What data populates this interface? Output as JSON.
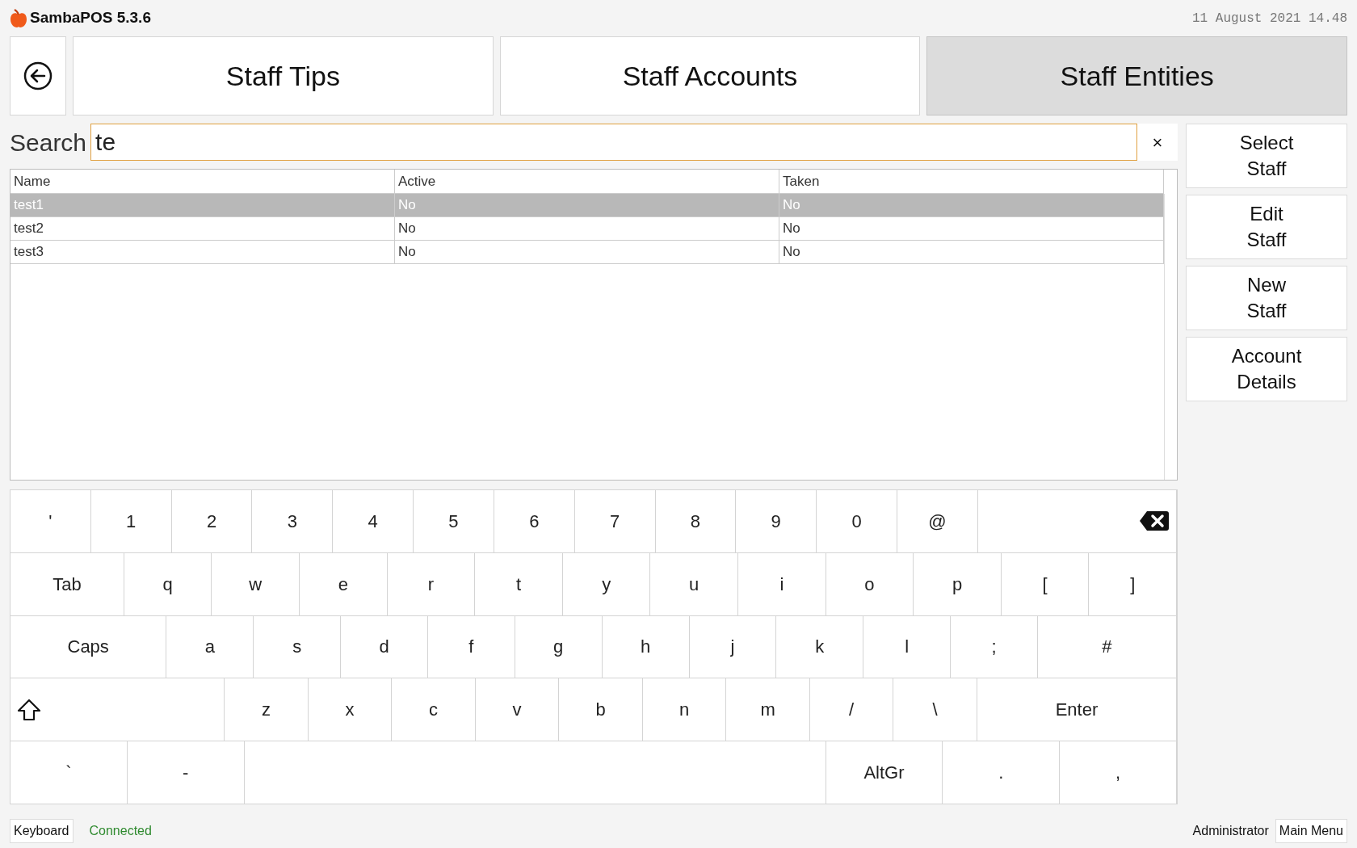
{
  "app": {
    "title": "SambaPOS 5.3.6",
    "datetime": "11 August 2021 14.48"
  },
  "tabs": [
    {
      "label": "Staff Tips",
      "selected": false
    },
    {
      "label": "Staff Accounts",
      "selected": false
    },
    {
      "label": "Staff Entities",
      "selected": true
    }
  ],
  "search": {
    "label": "Search",
    "value": "te",
    "clear": "×"
  },
  "table": {
    "columns": [
      "Name",
      "Active",
      "Taken"
    ],
    "rows": [
      {
        "cells": [
          "test1",
          "No",
          "No"
        ],
        "selected": true
      },
      {
        "cells": [
          "test2",
          "No",
          "No"
        ],
        "selected": false
      },
      {
        "cells": [
          "test3",
          "No",
          "No"
        ],
        "selected": false
      }
    ]
  },
  "actions": [
    [
      "Select",
      "Staff"
    ],
    [
      "Edit",
      "Staff"
    ],
    [
      "New",
      "Staff"
    ],
    [
      "Account",
      "Details"
    ]
  ],
  "keyboard": [
    [
      {
        "kind": "char",
        "label": "'"
      },
      {
        "kind": "char",
        "label": "1"
      },
      {
        "kind": "char",
        "label": "2"
      },
      {
        "kind": "char",
        "label": "3"
      },
      {
        "kind": "char",
        "label": "4"
      },
      {
        "kind": "char",
        "label": "5"
      },
      {
        "kind": "char",
        "label": "6"
      },
      {
        "kind": "char",
        "label": "7"
      },
      {
        "kind": "char",
        "label": "8"
      },
      {
        "kind": "char",
        "label": "9"
      },
      {
        "kind": "char",
        "label": "0"
      },
      {
        "kind": "char",
        "label": "@"
      },
      {
        "kind": "backspace"
      }
    ],
    [
      {
        "kind": "char",
        "label": "Tab"
      },
      {
        "kind": "char",
        "label": "q"
      },
      {
        "kind": "char",
        "label": "w"
      },
      {
        "kind": "char",
        "label": "e"
      },
      {
        "kind": "char",
        "label": "r"
      },
      {
        "kind": "char",
        "label": "t"
      },
      {
        "kind": "char",
        "label": "y"
      },
      {
        "kind": "char",
        "label": "u"
      },
      {
        "kind": "char",
        "label": "i"
      },
      {
        "kind": "char",
        "label": "o"
      },
      {
        "kind": "char",
        "label": "p"
      },
      {
        "kind": "char",
        "label": "["
      },
      {
        "kind": "char",
        "label": "]"
      }
    ],
    [
      {
        "kind": "char",
        "label": "Caps"
      },
      {
        "kind": "char",
        "label": "a"
      },
      {
        "kind": "char",
        "label": "s"
      },
      {
        "kind": "char",
        "label": "d"
      },
      {
        "kind": "char",
        "label": "f"
      },
      {
        "kind": "char",
        "label": "g"
      },
      {
        "kind": "char",
        "label": "h"
      },
      {
        "kind": "char",
        "label": "j"
      },
      {
        "kind": "char",
        "label": "k"
      },
      {
        "kind": "char",
        "label": "l"
      },
      {
        "kind": "char",
        "label": ";"
      },
      {
        "kind": "char",
        "label": "#"
      }
    ],
    [
      {
        "kind": "shift"
      },
      {
        "kind": "char",
        "label": "z"
      },
      {
        "kind": "char",
        "label": "x"
      },
      {
        "kind": "char",
        "label": "c"
      },
      {
        "kind": "char",
        "label": "v"
      },
      {
        "kind": "char",
        "label": "b"
      },
      {
        "kind": "char",
        "label": "n"
      },
      {
        "kind": "char",
        "label": "m"
      },
      {
        "kind": "char",
        "label": "/"
      },
      {
        "kind": "char",
        "label": "\\"
      },
      {
        "kind": "char",
        "label": "Enter"
      }
    ],
    [
      {
        "kind": "char",
        "label": "`"
      },
      {
        "kind": "char",
        "label": "-"
      },
      {
        "kind": "space"
      },
      {
        "kind": "char",
        "label": "AltGr"
      },
      {
        "kind": "char",
        "label": "."
      },
      {
        "kind": "char",
        "label": ","
      }
    ]
  ],
  "status": {
    "keyboard": "Keyboard",
    "connection": "Connected",
    "user": "Administrator",
    "menu": "Main Menu"
  }
}
